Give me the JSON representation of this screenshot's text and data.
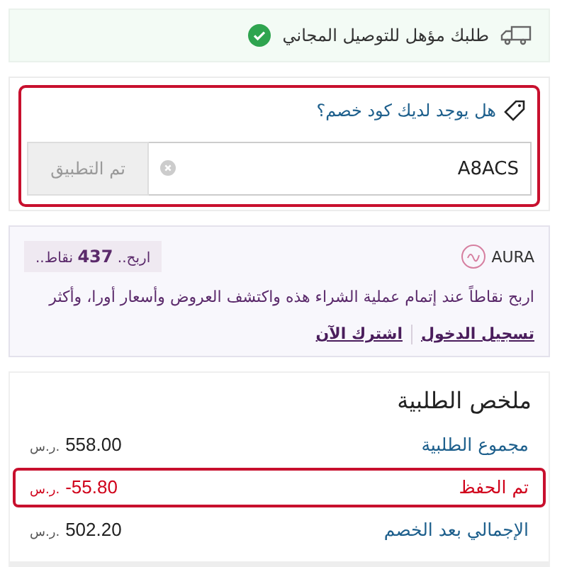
{
  "delivery_banner": {
    "text": "طلبك مؤهل للتوصيل المجاني",
    "eligible": true
  },
  "coupon": {
    "highlighted": true,
    "question": "هل يوجد لديك كود خصم؟",
    "value": "A8ACS",
    "apply_button": {
      "label": "تم التطبيق",
      "disabled": true
    }
  },
  "loyalty": {
    "brand": "AURA",
    "badge": "اربح.. **437** نقاط..",
    "description": "اربح نقاطاً عند إتمام عملية الشراء هذه واكتشف العروض وأسعار أورا، وأكثر",
    "links": [
      "تسجيل الدخول",
      "اشترك الآن"
    ]
  },
  "summary": {
    "title": "ملخص الطلبية",
    "rows": [
      {
        "label": "مجموع الطلبية",
        "amount": "558.00",
        "currency": "ر.س.",
        "kind": "normal",
        "highlighted": false
      },
      {
        "label": "تم الحفظ",
        "amount": "-55.80",
        "currency": "ر.س.",
        "kind": "discount",
        "highlighted": true
      },
      {
        "label": "الإجمالي بعد الخصم",
        "amount": "502.20",
        "currency": "ر.س.",
        "kind": "normal",
        "highlighted": false
      }
    ]
  }
}
